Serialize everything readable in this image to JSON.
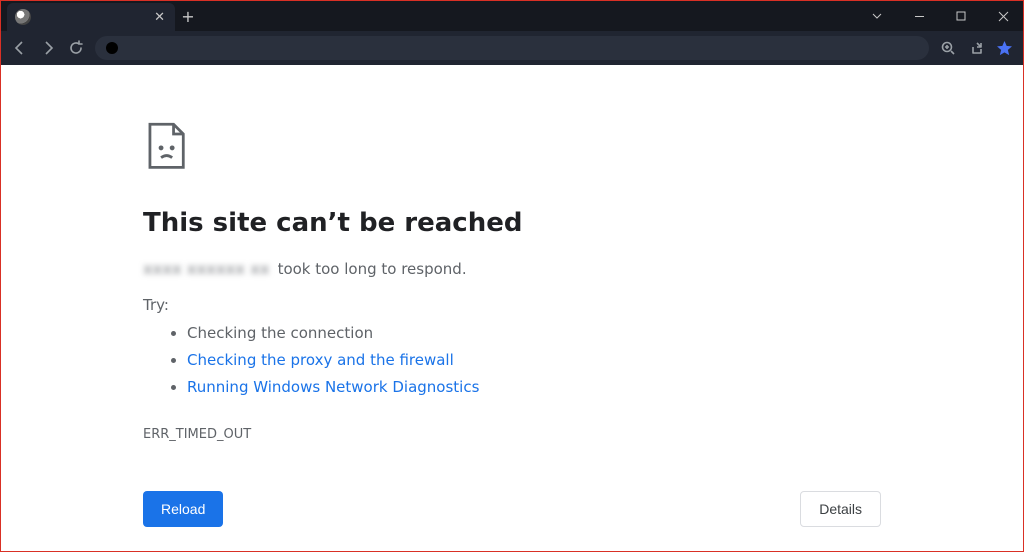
{
  "tab": {
    "title": ""
  },
  "error": {
    "heading": "This site can’t be reached",
    "host_blurred": "xxxx xxxxxx xx",
    "message_tail": "took too long to respond.",
    "try_label": "Try:",
    "suggestions": {
      "check_connection": "Checking the connection",
      "proxy_firewall": "Checking the proxy and the firewall",
      "network_diag": "Running Windows Network Diagnostics"
    },
    "error_code": "ERR_TIMED_OUT"
  },
  "buttons": {
    "reload": "Reload",
    "details": "Details"
  }
}
